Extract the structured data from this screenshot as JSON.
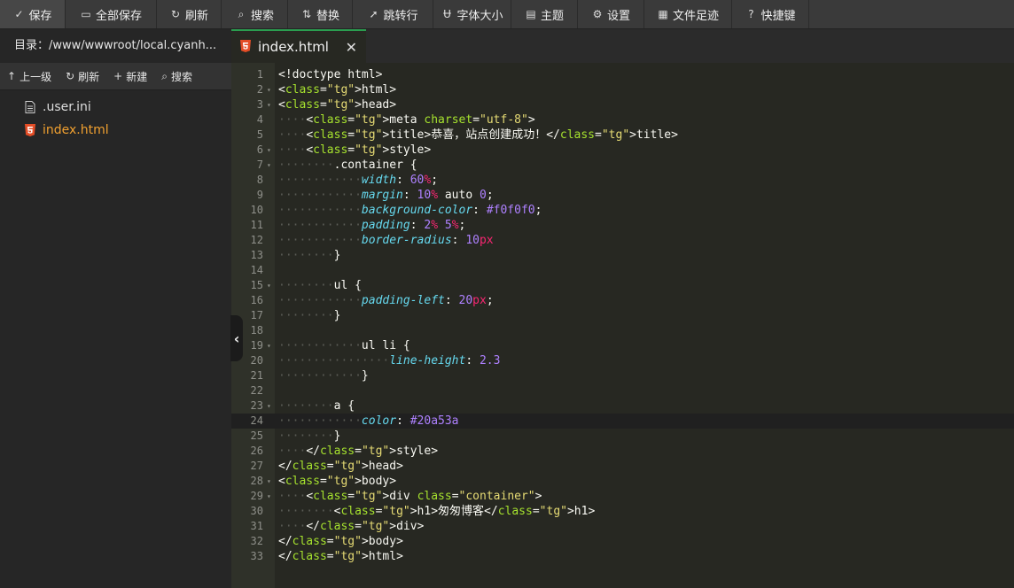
{
  "toolbar": {
    "buttons": [
      {
        "label": "保存",
        "icon": "save-icon",
        "glyph": "✓"
      },
      {
        "label": "全部保存",
        "icon": "save-all-icon",
        "glyph": "▭"
      },
      {
        "label": "刷新",
        "icon": "refresh-icon",
        "glyph": "↻"
      },
      {
        "label": "搜索",
        "icon": "search-icon",
        "glyph": "⌕"
      },
      {
        "label": "替换",
        "icon": "replace-icon",
        "glyph": "⇅"
      },
      {
        "label": "跳转行",
        "icon": "goto-line-icon",
        "glyph": "➚"
      },
      {
        "label": "字体大小",
        "icon": "font-size-icon",
        "glyph": "Ʉ"
      },
      {
        "label": "主题",
        "icon": "theme-icon",
        "glyph": "▤"
      },
      {
        "label": "设置",
        "icon": "gear-icon",
        "glyph": "⚙"
      },
      {
        "label": "文件足迹",
        "icon": "history-icon",
        "glyph": "▦"
      },
      {
        "label": "快捷键",
        "icon": "help-icon",
        "glyph": "?"
      }
    ]
  },
  "sidebar": {
    "directory": "目录：/www/wwwroot/local.cyanh...",
    "actions": [
      {
        "label": "上一级",
        "icon": "arrow-up-icon",
        "glyph": "↑"
      },
      {
        "label": "刷新",
        "icon": "refresh-icon",
        "glyph": "↻"
      },
      {
        "label": "新建",
        "icon": "plus-icon",
        "glyph": "+"
      },
      {
        "label": "搜索",
        "icon": "search-icon",
        "glyph": "⌕"
      }
    ],
    "files": [
      {
        "name": ".user.ini",
        "type": "text",
        "active": false
      },
      {
        "name": "index.html",
        "type": "html",
        "active": true
      }
    ]
  },
  "tabs": [
    {
      "label": "index.html",
      "close": "✕"
    }
  ],
  "editor": {
    "active_line": 24,
    "colors": {
      "background": "#272822",
      "tag": "#f92672",
      "attr": "#a6e22e",
      "string": "#e6db74",
      "property": "#66d9ef",
      "number": "#ae81ff"
    },
    "lines": [
      {
        "n": "1",
        "fold": "",
        "code": "<!doctype html>"
      },
      {
        "n": "2",
        "fold": "▾",
        "code": "<html>"
      },
      {
        "n": "3",
        "fold": "▾",
        "code": "<head>"
      },
      {
        "n": "4",
        "fold": "",
        "code": "    <meta charset=\"utf-8\">"
      },
      {
        "n": "5",
        "fold": "",
        "code": "    <title>恭喜，站点创建成功！</title>"
      },
      {
        "n": "6",
        "fold": "▾",
        "code": "    <style>"
      },
      {
        "n": "7",
        "fold": "▾",
        "code": "        .container {"
      },
      {
        "n": "8",
        "fold": "",
        "code": "            width: 60%;"
      },
      {
        "n": "9",
        "fold": "",
        "code": "            margin: 10% auto 0;"
      },
      {
        "n": "10",
        "fold": "",
        "code": "            background-color: #f0f0f0;"
      },
      {
        "n": "11",
        "fold": "",
        "code": "            padding: 2% 5%;"
      },
      {
        "n": "12",
        "fold": "",
        "code": "            border-radius: 10px"
      },
      {
        "n": "13",
        "fold": "",
        "code": "        }"
      },
      {
        "n": "14",
        "fold": "",
        "code": ""
      },
      {
        "n": "15",
        "fold": "▾",
        "code": "        ul {"
      },
      {
        "n": "16",
        "fold": "",
        "code": "            padding-left: 20px;"
      },
      {
        "n": "17",
        "fold": "",
        "code": "        }"
      },
      {
        "n": "18",
        "fold": "",
        "code": ""
      },
      {
        "n": "19",
        "fold": "▾",
        "code": "            ul li {"
      },
      {
        "n": "20",
        "fold": "",
        "code": "                line-height: 2.3"
      },
      {
        "n": "21",
        "fold": "",
        "code": "            }"
      },
      {
        "n": "22",
        "fold": "",
        "code": ""
      },
      {
        "n": "23",
        "fold": "▾",
        "code": "        a {"
      },
      {
        "n": "24",
        "fold": "",
        "code": "            color: #20a53a"
      },
      {
        "n": "25",
        "fold": "",
        "code": "        }"
      },
      {
        "n": "26",
        "fold": "",
        "code": "    </style>"
      },
      {
        "n": "27",
        "fold": "",
        "code": "</head>"
      },
      {
        "n": "28",
        "fold": "▾",
        "code": "<body>"
      },
      {
        "n": "29",
        "fold": "▾",
        "code": "    <div class=\"container\">"
      },
      {
        "n": "30",
        "fold": "",
        "code": "        <h1>匆匆博客</h1>"
      },
      {
        "n": "31",
        "fold": "",
        "code": "    </div>"
      },
      {
        "n": "32",
        "fold": "",
        "code": "</body>"
      },
      {
        "n": "33",
        "fold": "",
        "code": "</html>"
      }
    ]
  }
}
